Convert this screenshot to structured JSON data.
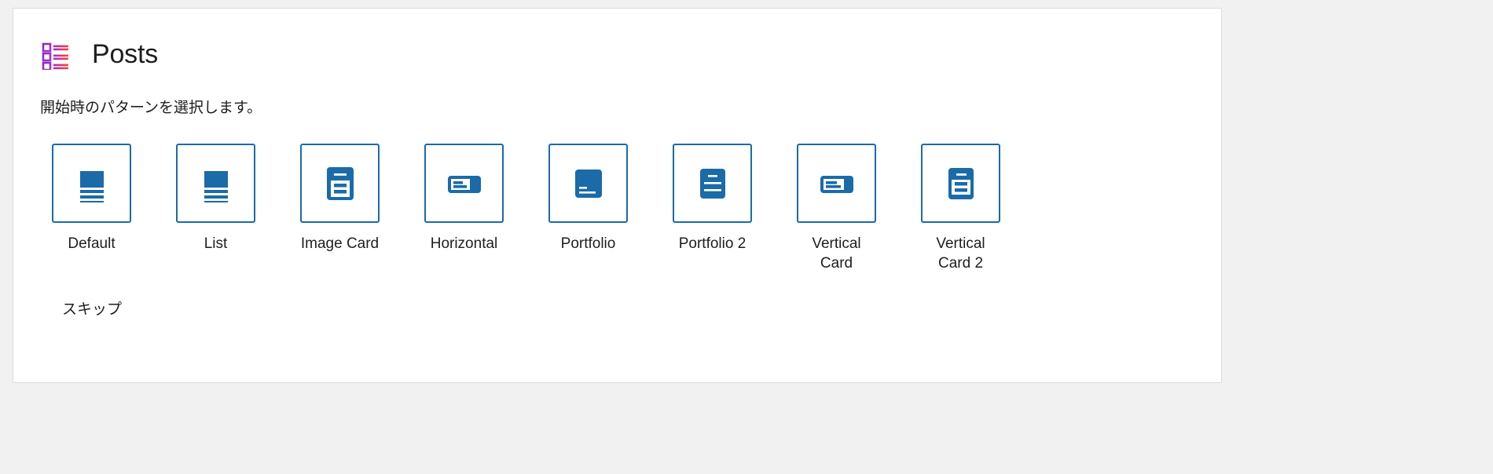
{
  "panel": {
    "header": {
      "icon": "posts-list-icon",
      "title": "Posts"
    },
    "description": "開始時のパターンを選択します。",
    "patterns": [
      {
        "label": "Default",
        "icon": "pattern-default-icon"
      },
      {
        "label": "List",
        "icon": "pattern-list-icon"
      },
      {
        "label": "Image Card",
        "icon": "pattern-image-card-icon"
      },
      {
        "label": "Horizontal",
        "icon": "pattern-horizontal-icon"
      },
      {
        "label": "Portfolio",
        "icon": "pattern-portfolio-icon"
      },
      {
        "label": "Portfolio 2",
        "icon": "pattern-portfolio-2-icon"
      },
      {
        "label": "Vertical Card",
        "icon": "pattern-vertical-card-icon"
      },
      {
        "label": "Vertical Card 2",
        "icon": "pattern-vertical-card-2-icon"
      }
    ],
    "skip_label": "スキップ"
  },
  "colors": {
    "accent_blue": "#1a6ba8",
    "icon_gradient_start": "#8f32c8",
    "icon_gradient_end": "#f1453d",
    "panel_background": "#ffffff",
    "page_background": "#f1f1f1",
    "text": "#1e1e1e"
  }
}
